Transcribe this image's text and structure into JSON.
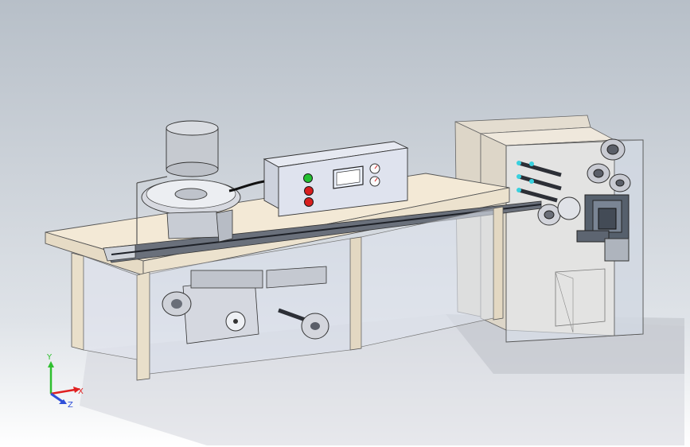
{
  "triad": {
    "y_label": "Y",
    "x_label": "X",
    "z_label": "Z",
    "y_color": "#2fbf2f",
    "x_color": "#e02020",
    "z_color": "#2f4fd9"
  },
  "colors": {
    "background_top": "#b7bfc8",
    "table_top": "#f3e9d6",
    "panel": "#e8e0d2",
    "steel": "#c9cbd3",
    "dark_steel": "#4b4f5a",
    "green_button": "#23c030",
    "red_button": "#d81e1e"
  }
}
